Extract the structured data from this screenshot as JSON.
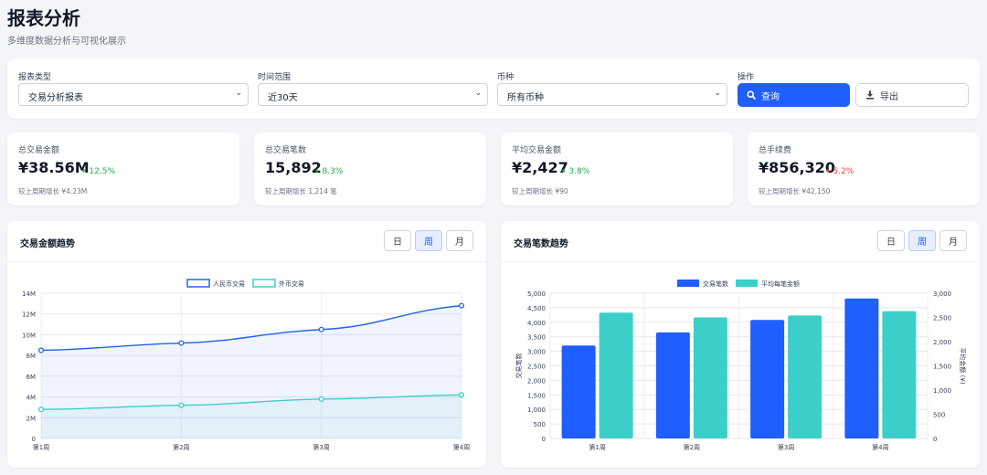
{
  "page": {
    "title": "报表分析",
    "subtitle": "多维度数据分析与可视化展示"
  },
  "filters": {
    "report_type": {
      "label": "报表类型",
      "value": "交易分析报表"
    },
    "time_range": {
      "label": "时间范围",
      "value": "近30天"
    },
    "currency": {
      "label": "币种",
      "value": "所有币种"
    },
    "actions": {
      "label": "操作",
      "query": "查询",
      "export": "导出"
    }
  },
  "stats": [
    {
      "label": "总交易金额",
      "value": "¥38.56M",
      "change": "12.5%",
      "direction": "up",
      "color": "#22b14c",
      "foot": "较上周期增长 ¥4.23M"
    },
    {
      "label": "总交易笔数",
      "value": "15,892",
      "change": "8.3%",
      "direction": "up",
      "color": "#22b14c",
      "foot": "较上周期增长 1,214 笔"
    },
    {
      "label": "平均交易金额",
      "value": "¥2,427",
      "change": "3.8%",
      "direction": "up",
      "color": "#22b14c",
      "foot": "较上周期增长 ¥90"
    },
    {
      "label": "总手续费",
      "value": "¥856,320",
      "change": "5.2%",
      "direction": "up",
      "color": "#ef4444",
      "foot": "较上周期增长 ¥42,150"
    }
  ],
  "periods": [
    "日",
    "周",
    "月"
  ],
  "colors": {
    "primary": "#1f5eff",
    "teal": "#3ccfca",
    "green": "#22b14c",
    "red": "#ef4444"
  },
  "chart_data": [
    {
      "type": "line",
      "title": "交易金额趋势",
      "categories": [
        "第1周",
        "第2周",
        "第3周",
        "第4周"
      ],
      "series": [
        {
          "name": "人民币交易",
          "values": [
            8500000,
            9200000,
            10500000,
            12800000
          ],
          "color": "#2563eb"
        },
        {
          "name": "外币交易",
          "values": [
            2800000,
            3200000,
            3800000,
            4200000
          ],
          "color": "#3ccfca"
        }
      ],
      "yticks": [
        "0",
        "2M",
        "4M",
        "6M",
        "8M",
        "10M",
        "12M",
        "14M"
      ],
      "ylim": [
        0,
        14000000
      ],
      "legend": "top",
      "grid": true
    },
    {
      "type": "bar",
      "title": "交易笔数趋势",
      "categories": [
        "第1周",
        "第2周",
        "第3周",
        "第4周"
      ],
      "series": [
        {
          "name": "交易笔数",
          "values": [
            3200,
            3650,
            4080,
            4820
          ],
          "axis": "left",
          "color": "#1f5eff"
        },
        {
          "name": "平均每笔金额",
          "values": [
            2600,
            2500,
            2540,
            2630
          ],
          "axis": "right",
          "color": "#3ccfca"
        }
      ],
      "ylabel": "交易笔数",
      "y2label": "平均金额 (¥)",
      "yticks": [
        "0",
        "500",
        "1,000",
        "1,500",
        "2,000",
        "2,500",
        "3,000",
        "3,500",
        "4,000",
        "4,500",
        "5,000"
      ],
      "y2ticks": [
        "0",
        "500",
        "1,000",
        "1,500",
        "2,000",
        "2,500",
        "3,000"
      ],
      "ylim": [
        0,
        5000
      ],
      "y2lim": [
        0,
        3000
      ],
      "legend": "top",
      "grid": true
    }
  ]
}
